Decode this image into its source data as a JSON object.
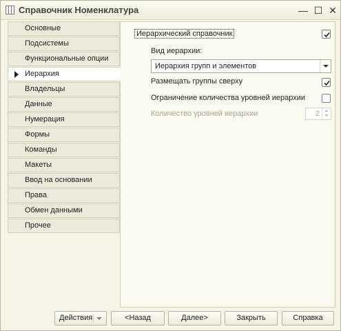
{
  "window": {
    "title": "Справочник Номенклатура",
    "controls": {
      "minimize": "—",
      "maximize": "☐",
      "close": "✕"
    }
  },
  "sidebar": {
    "active_index": 3,
    "items": [
      {
        "label": "Основные"
      },
      {
        "label": "Подсистемы"
      },
      {
        "label": "Функциональные опции"
      },
      {
        "label": "Иерархия"
      },
      {
        "label": "Владельцы"
      },
      {
        "label": "Данные"
      },
      {
        "label": "Нумерация"
      },
      {
        "label": "Формы"
      },
      {
        "label": "Команды"
      },
      {
        "label": "Макеты"
      },
      {
        "label": "Ввод на основании"
      },
      {
        "label": "Права"
      },
      {
        "label": "Обмен данными"
      },
      {
        "label": "Прочее"
      }
    ]
  },
  "panel": {
    "hierarchical": {
      "label": "Иерархический справочник",
      "checked": true
    },
    "hierarchy_type": {
      "label": "Вид иерархии:",
      "value": "Иерархия групп и элементов"
    },
    "groups_on_top": {
      "label": "Размещать группы сверху",
      "checked": true
    },
    "limit_levels": {
      "label": "Ограничение количества уровней иерархии",
      "checked": false
    },
    "levels_count": {
      "label": "Количество уровней иерархии",
      "value": "2",
      "disabled": true
    }
  },
  "footer": {
    "actions_label": "Действия",
    "back_label": "<Назад",
    "next_label": "Далее>",
    "close_label": "Закрыть",
    "help_label": "Справка"
  }
}
